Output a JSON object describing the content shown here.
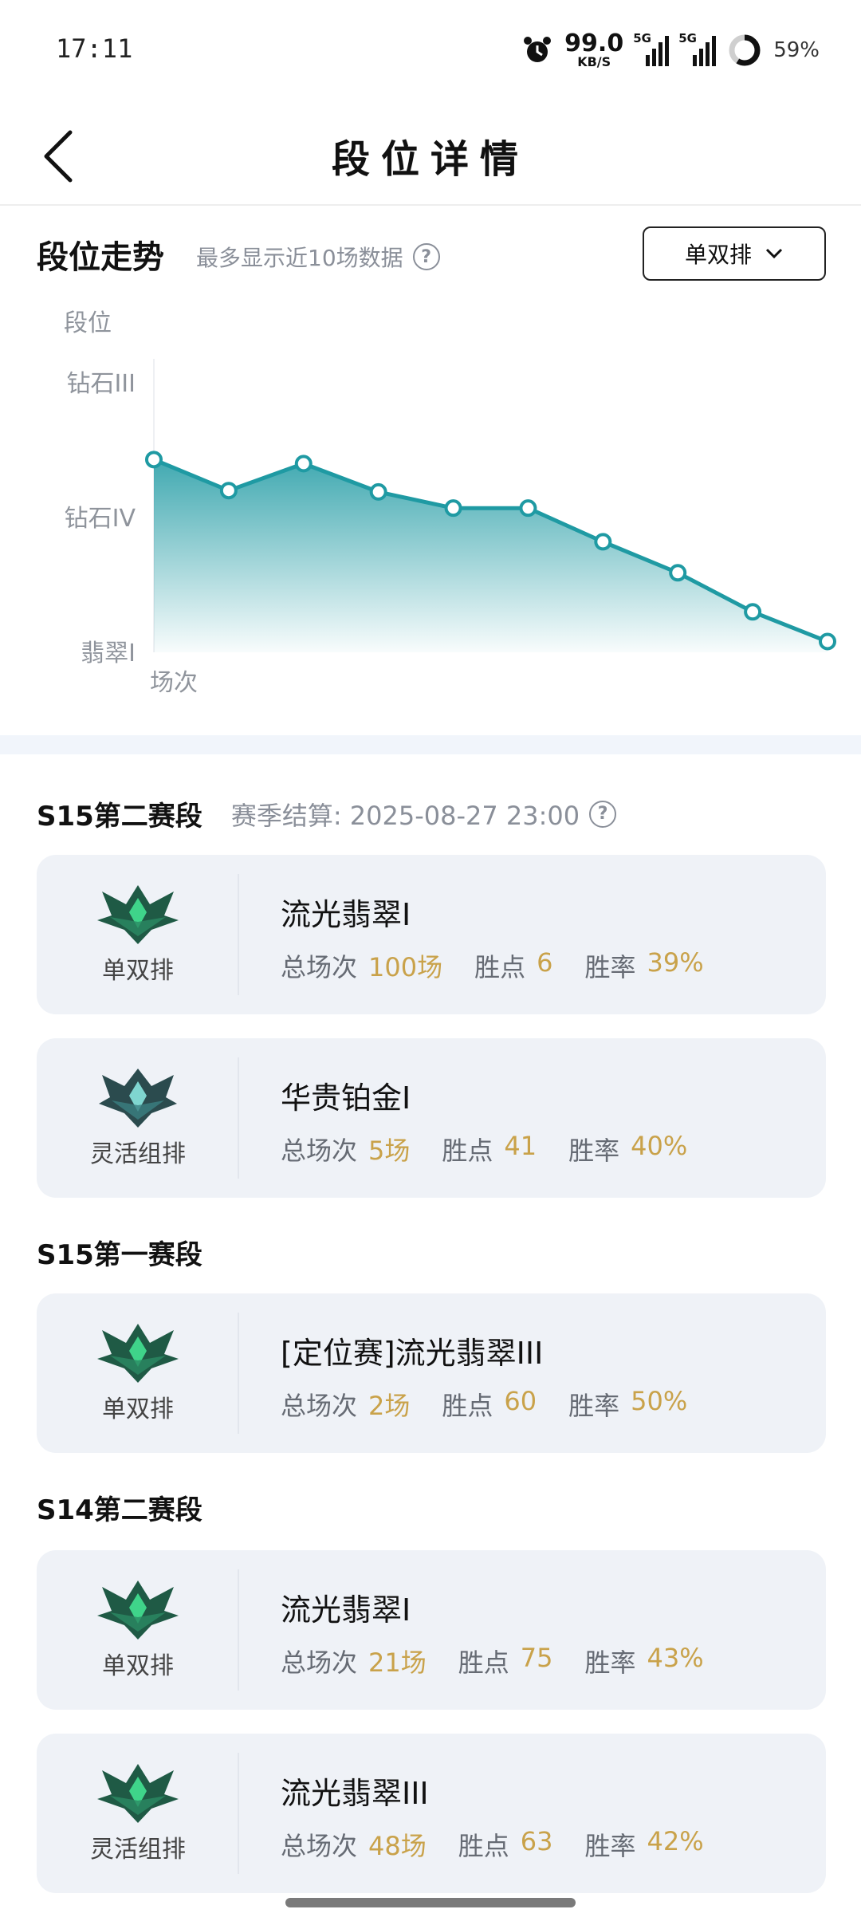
{
  "status_bar": {
    "time": "17:11",
    "net_speed": "99.0",
    "net_unit": "KB/S",
    "signal1": "5G",
    "signal2": "5G",
    "battery": "59%"
  },
  "header": {
    "title": "段位详情"
  },
  "trend": {
    "title": "段位走势",
    "subtitle": "最多显示近10场数据",
    "mode": "单双排"
  },
  "chart_data": {
    "type": "area",
    "ylabel": "段位",
    "xlabel": "场次",
    "y_ticks": [
      "翡翠I",
      "钻石IV",
      "钻石III"
    ],
    "x": [
      1,
      2,
      3,
      4,
      5,
      6,
      7,
      8,
      9,
      10
    ],
    "values": [
      1.43,
      1.2,
      1.4,
      1.19,
      1.07,
      1.07,
      0.82,
      0.59,
      0.3,
      0.08
    ],
    "ylim": [
      0,
      2
    ],
    "color": "#1f9aa3",
    "grid": false
  },
  "seasons": [
    {
      "name": "S15第二赛段",
      "settle": "赛季结算: 2025-08-27 23:00",
      "cards": [
        {
          "queue": "单双排",
          "rank": "流光翡翠I",
          "games_label": "总场次",
          "games": "100场",
          "points_label": "胜点",
          "points": "6",
          "winrate_label": "胜率",
          "winrate": "39%"
        },
        {
          "queue": "灵活组排",
          "rank": "华贵铂金I",
          "games_label": "总场次",
          "games": "5场",
          "points_label": "胜点",
          "points": "41",
          "winrate_label": "胜率",
          "winrate": "40%"
        }
      ]
    },
    {
      "name": "S15第一赛段",
      "cards": [
        {
          "queue": "单双排",
          "rank": "[定位赛]流光翡翠III",
          "games_label": "总场次",
          "games": "2场",
          "points_label": "胜点",
          "points": "60",
          "winrate_label": "胜率",
          "winrate": "50%"
        }
      ]
    },
    {
      "name": "S14第二赛段",
      "cards": [
        {
          "queue": "单双排",
          "rank": "流光翡翠I",
          "games_label": "总场次",
          "games": "21场",
          "points_label": "胜点",
          "points": "75",
          "winrate_label": "胜率",
          "winrate": "43%"
        },
        {
          "queue": "灵活组排",
          "rank": "流光翡翠III",
          "games_label": "总场次",
          "games": "48场",
          "points_label": "胜点",
          "points": "63",
          "winrate_label": "胜率",
          "winrate": "42%"
        }
      ]
    }
  ]
}
